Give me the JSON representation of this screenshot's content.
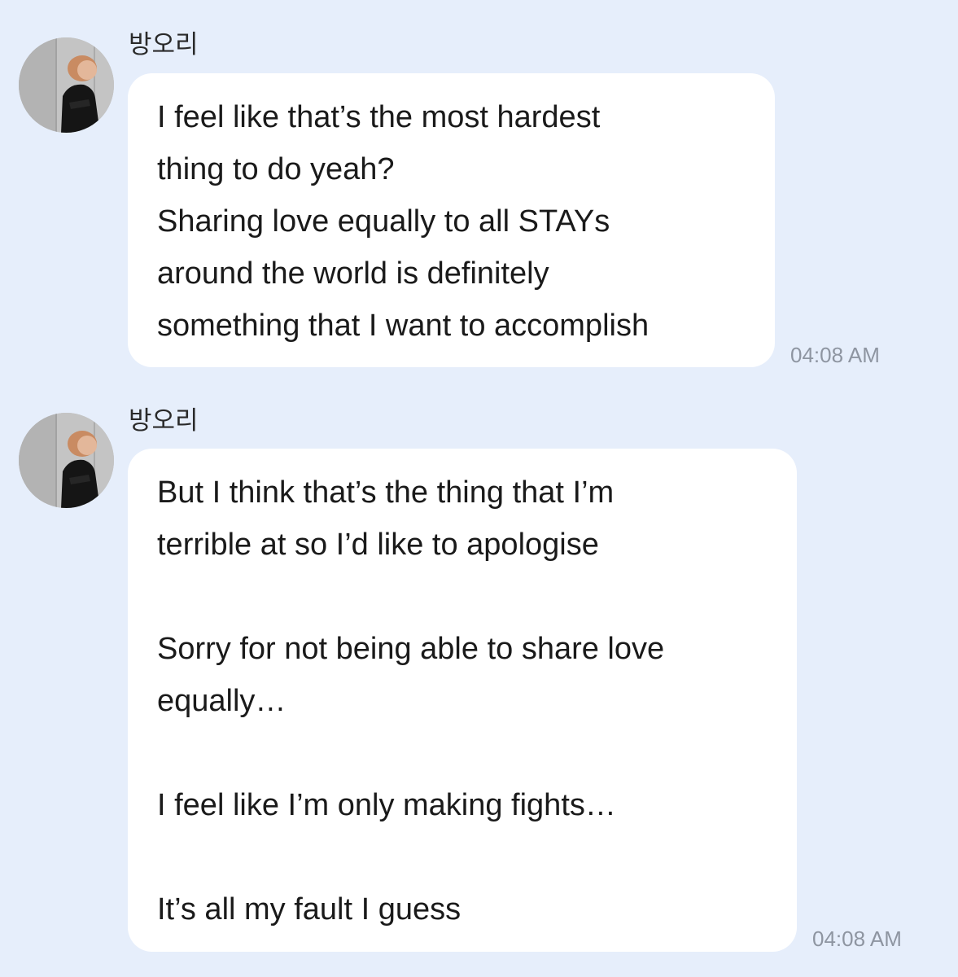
{
  "colors": {
    "background": "#E6EEFB",
    "bubble": "#FFFFFF",
    "message_text": "#1a1a1a",
    "timestamp_text": "#8e95a1"
  },
  "messages": [
    {
      "sender": "방오리",
      "avatar_icon": "profile-photo",
      "lines": [
        "I feel like that’s the most hardest",
        "thing to do yeah?",
        "Sharing love equally to all STAYs",
        "around the world is definitely",
        "something that I want to accomplish"
      ],
      "time": "04:08 AM"
    },
    {
      "sender": "방오리",
      "avatar_icon": "profile-photo",
      "lines": [
        "But I think that’s the thing that I’m",
        "terrible at so I’d like to apologise",
        "",
        "Sorry for not being able to share love",
        "equally…",
        "",
        "I feel like I’m only making fights…",
        "",
        "It’s all my fault I guess"
      ],
      "time": "04:08 AM"
    }
  ]
}
